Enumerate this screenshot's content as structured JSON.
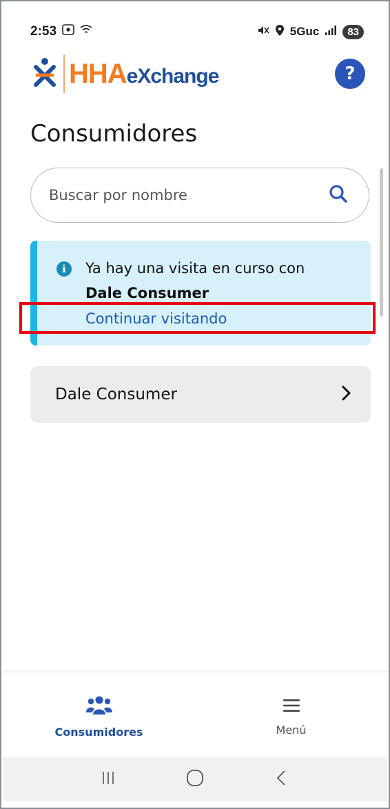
{
  "status_bar": {
    "time": "2:53",
    "network": "5Guc",
    "battery": "83"
  },
  "header": {
    "logo_hha": "HHA",
    "logo_exchange": "eXchange",
    "help_label": "?"
  },
  "page": {
    "title": "Consumidores"
  },
  "search": {
    "placeholder": "Buscar por nombre"
  },
  "banner": {
    "message": "Ya hay una visita en curso con",
    "consumer_name": "Dale Consumer",
    "link_label": "Continuar visitando"
  },
  "consumers": [
    {
      "name": "Dale Consumer"
    }
  ],
  "bottom_nav": {
    "items": [
      {
        "label": "Consumidores",
        "icon": "users-icon",
        "active": true
      },
      {
        "label": "Menú",
        "icon": "hamburger-icon",
        "active": false
      }
    ]
  },
  "colors": {
    "brand_blue": "#2a56b8",
    "brand_orange": "#f47b20",
    "banner_bg": "#d6f1fa",
    "banner_accent": "#1bb6e4",
    "highlight_red": "#e60012"
  }
}
